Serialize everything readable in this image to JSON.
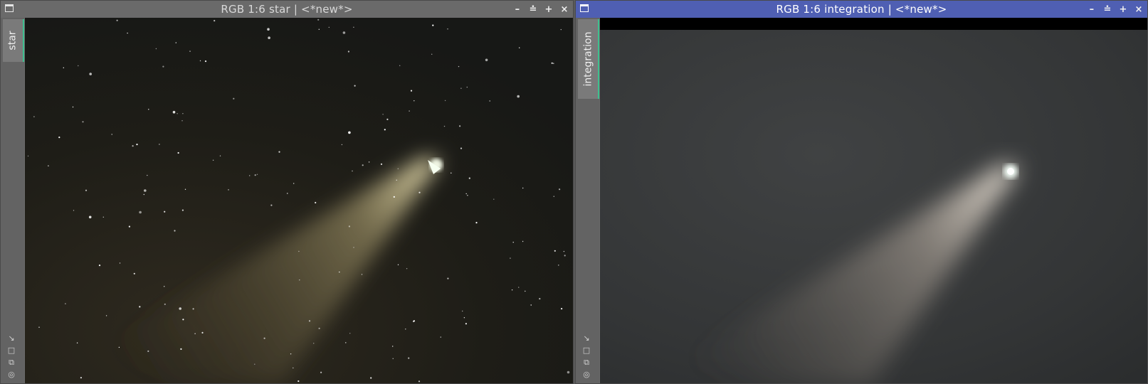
{
  "windows": {
    "left": {
      "title": "RGB 1:6 star | <*new*>",
      "tab_label": "star",
      "active": false
    },
    "right": {
      "title": "RGB 1:6 integration | <*new*>",
      "tab_label": "integration",
      "active": true
    }
  },
  "controls": {
    "minimize": "–",
    "shade": "≐",
    "maximize": "+",
    "close": "×"
  },
  "side_icons": [
    "fit-view-icon",
    "zoom-icon",
    "clone-icon",
    "target-icon"
  ],
  "colors": {
    "active_titlebar": "#4f5fb3",
    "inactive_titlebar": "#6a6a6a",
    "tab_accent": "#3fbf8f"
  }
}
